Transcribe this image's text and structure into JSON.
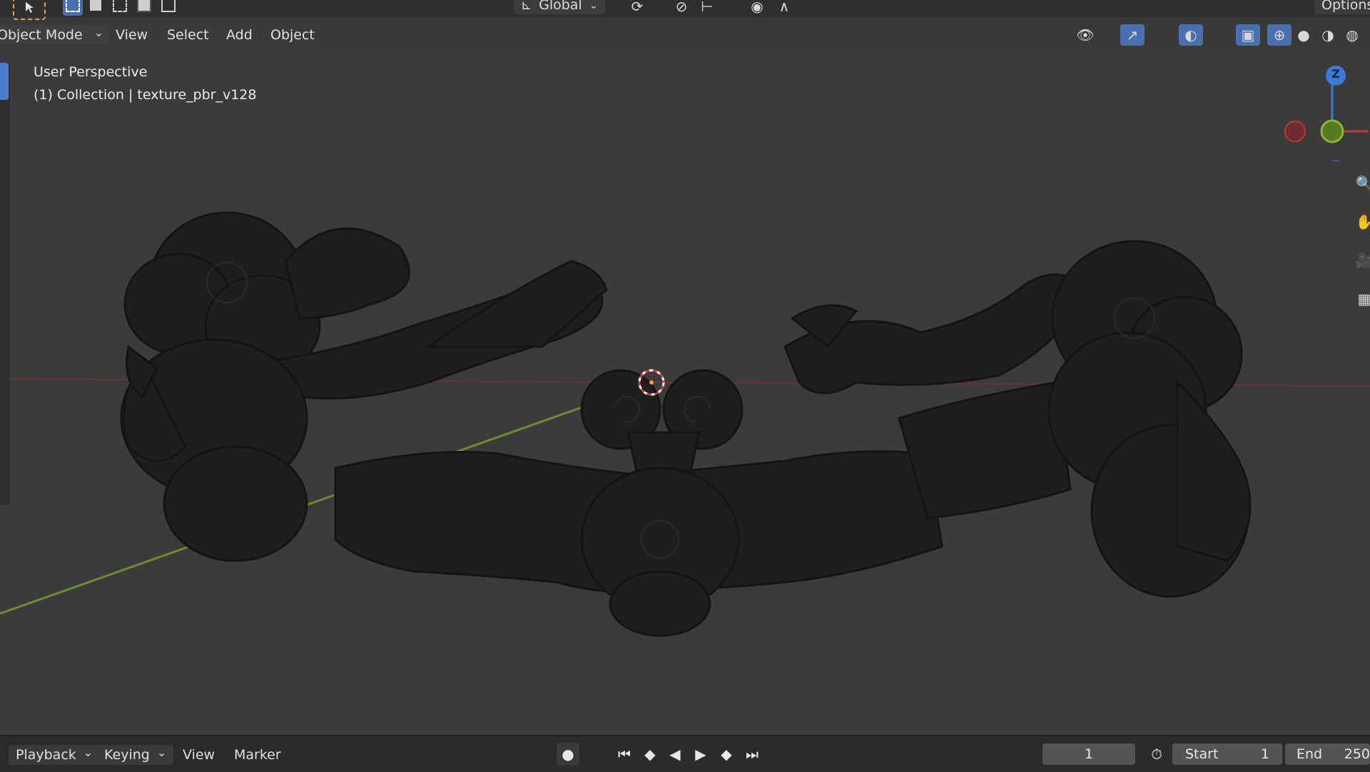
{
  "top_toolbar": {
    "transform_orientation": "Global",
    "options_label": "Options"
  },
  "header": {
    "mode": "Object Mode",
    "menu": [
      "View",
      "Select",
      "Add",
      "Object"
    ]
  },
  "viewport": {
    "view_name": "User Perspective",
    "collection_info": "(1) Collection | texture_pbr_v128",
    "gizmo_axis_label": "Z"
  },
  "timeline": {
    "playback_label": "Playback",
    "keying_label": "Keying",
    "view_label": "View",
    "marker_label": "Marker",
    "current_frame": "1",
    "start_label": "Start",
    "start_value": "1",
    "end_label": "End",
    "end_value": "250"
  },
  "colors": {
    "viewport_bg": "#3b3b3c",
    "object_color": "#1e1e1e",
    "x_axis": "#c0392b",
    "y_axis": "#7aa33a",
    "z_axis": "#3d7ad6"
  }
}
